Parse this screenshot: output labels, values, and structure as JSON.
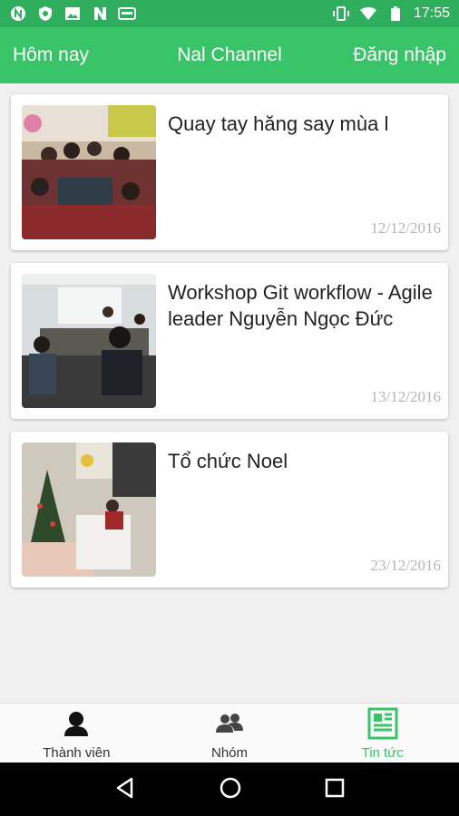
{
  "status_bar": {
    "time": "17:55",
    "left_icons": [
      "n-circle-icon",
      "shield-icon",
      "image-icon",
      "n-icon",
      "card-icon"
    ],
    "right_icons": [
      "vibrate-icon",
      "wifi-icon",
      "battery-icon"
    ]
  },
  "app_bar": {
    "left_label": "Hôm nay",
    "title": "Nal Channel",
    "right_label": "Đăng nhập"
  },
  "news": [
    {
      "title": "Quay tay hăng say mùa l",
      "date": "12/12/2016"
    },
    {
      "title": "Workshop Git workflow - Agile leader Nguyễn Ngọc Đức",
      "date": "13/12/2016"
    },
    {
      "title": "Tổ chức Noel",
      "date": "23/12/2016"
    }
  ],
  "bottom_nav": [
    {
      "label": "Thành viên",
      "icon": "person-icon"
    },
    {
      "label": "Nhóm",
      "icon": "group-icon"
    },
    {
      "label": "Tin tức",
      "icon": "news-icon",
      "active": true
    }
  ],
  "colors": {
    "status_bar": "#2fae5d",
    "app_bar": "#3ac46a",
    "active_tab": "#3ac46a",
    "date_text": "#b5b5b5"
  }
}
